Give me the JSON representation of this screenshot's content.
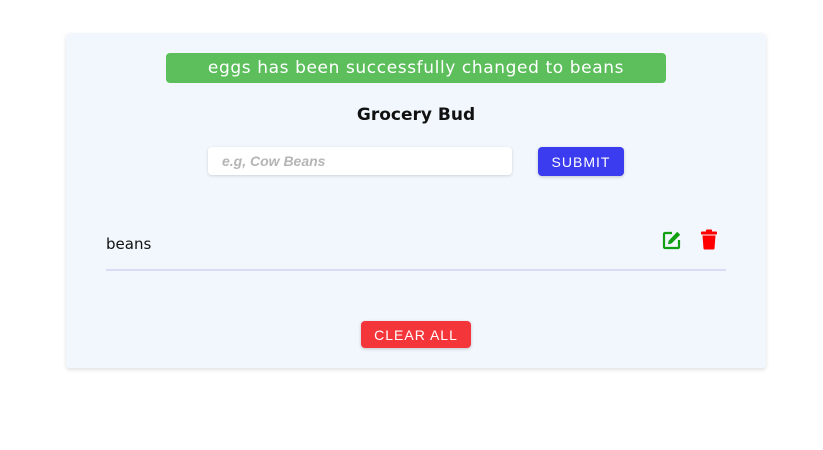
{
  "alert": {
    "text": "eggs has been successfully changed to beans",
    "color": "#5cbf5c"
  },
  "title": "Grocery Bud",
  "form": {
    "placeholder": "e.g, Cow Beans",
    "value": "",
    "submit_label": "SUBMIT"
  },
  "items": [
    {
      "label": "beans",
      "edit_icon": "edit-icon",
      "delete_icon": "trash-icon"
    }
  ],
  "clear_label": "CLEAR ALL",
  "colors": {
    "submit": "#3b3bef",
    "clear": "#f4363b",
    "edit": "#12a012",
    "delete": "#ff0000",
    "card": "#f1f7fd"
  }
}
